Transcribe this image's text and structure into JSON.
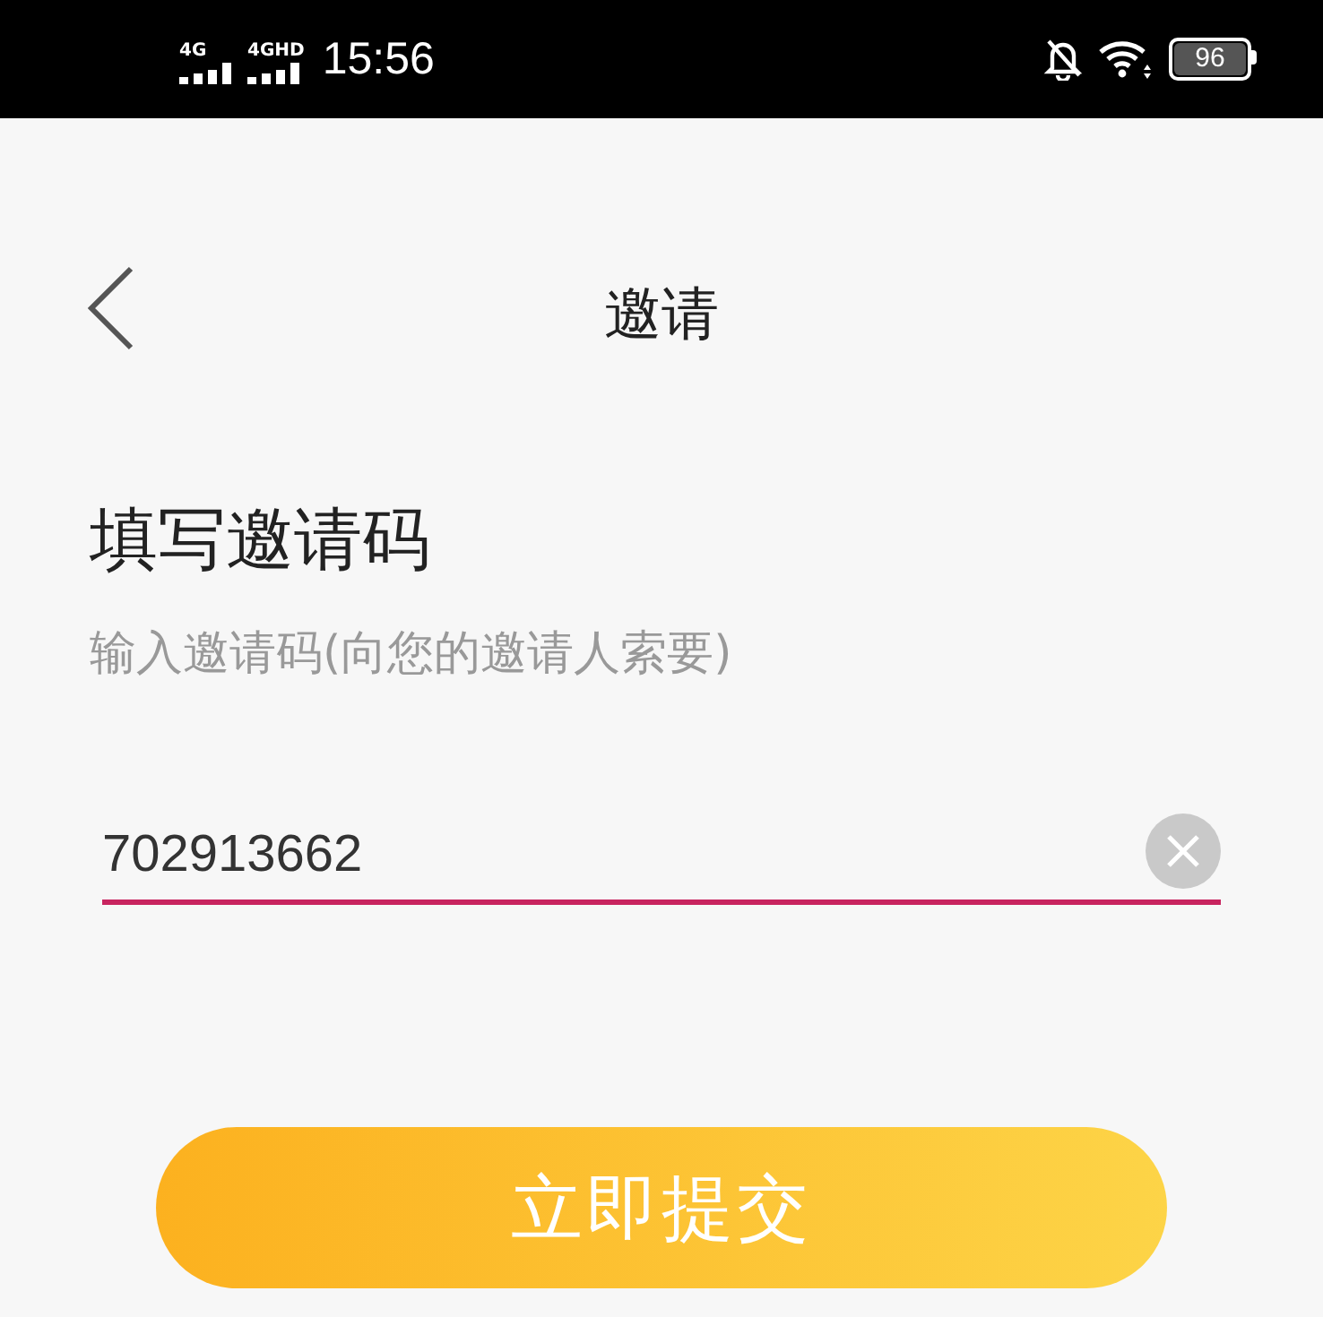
{
  "status_bar": {
    "networks": [
      {
        "label": "4G"
      },
      {
        "label": "4GHD"
      }
    ],
    "time": "15:56",
    "battery": "96"
  },
  "nav": {
    "title": "邀请"
  },
  "heading": "填写邀请码",
  "hint": "输入邀请码(向您的邀请人索要)",
  "code_field": {
    "value": "702913662"
  },
  "submit_button": {
    "label": "立即提交"
  }
}
